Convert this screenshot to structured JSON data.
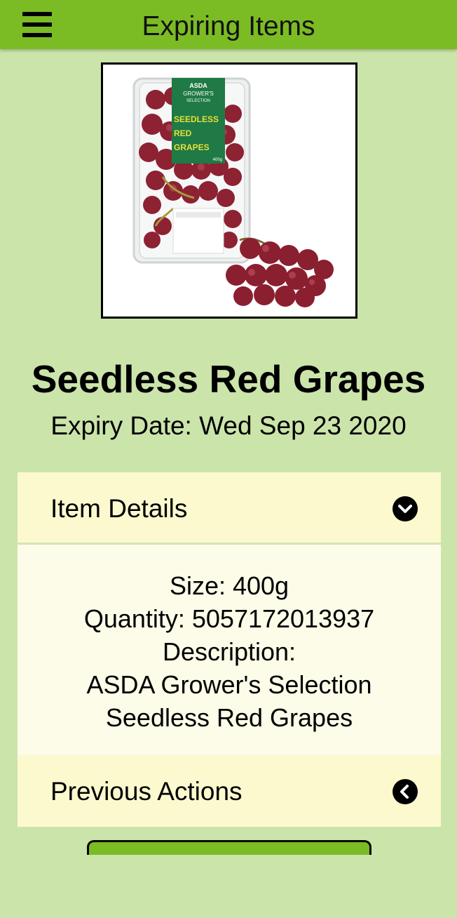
{
  "header": {
    "title": "Expiring Items",
    "menu_icon": "hamburger-menu-icon"
  },
  "product": {
    "name": "Seedless Red Grapes",
    "expiry": "Expiry Date: Wed Sep 23 2020",
    "image_label": {
      "brand": "ASDA",
      "line": "GROWER'S",
      "sub": "SELECTION",
      "title1": "SEEDLESS",
      "title2": "RED",
      "title3": "GRAPES",
      "weight": "400g"
    }
  },
  "item_details": {
    "label": "Item Details",
    "icon": "chevron-down-circle-icon",
    "size": "Size: 400g",
    "quantity": "Quantity: 5057172013937",
    "description_label": "Description:",
    "description_line1": "ASDA Grower's Selection",
    "description_line2": "Seedless Red Grapes"
  },
  "previous_actions": {
    "label": "Previous Actions",
    "icon": "chevron-left-circle-icon"
  },
  "colors": {
    "header_green": "#7bbc24",
    "background": "#cbe4aa",
    "panel_header": "#fdf9cf",
    "panel_body": "#fdfce9"
  }
}
